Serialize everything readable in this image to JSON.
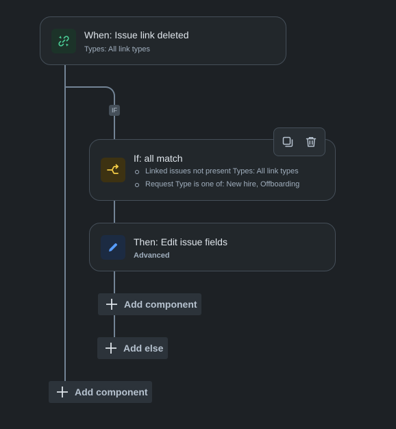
{
  "trigger": {
    "title": "When: Issue link deleted",
    "subtitle": "Types: All link types",
    "icon": "link-broken-icon",
    "icon_bg": "#1c3329",
    "icon_color": "#4bce97"
  },
  "branch_badge": "IF",
  "condition": {
    "title": "If: all match",
    "icon": "branch-icon",
    "icon_bg": "#3d3212",
    "icon_color": "#f5cd47",
    "items": [
      "Linked issues not present Types: All link types",
      "Request Type is one of: New hire, Offboarding"
    ]
  },
  "toolbar": {
    "duplicate_icon": "copy-icon",
    "delete_icon": "trash-icon"
  },
  "action": {
    "title": "Then: Edit issue fields",
    "subtitle": "Advanced",
    "icon": "pencil-icon",
    "icon_bg": "#1c2b42",
    "icon_color": "#579dff"
  },
  "buttons": {
    "add_component_inner": "Add component",
    "add_else": "Add else",
    "add_component_outer": "Add component"
  },
  "colors": {
    "background": "#1d2125",
    "card": "#22272b",
    "border": "#454f59",
    "connector": "#738496"
  }
}
